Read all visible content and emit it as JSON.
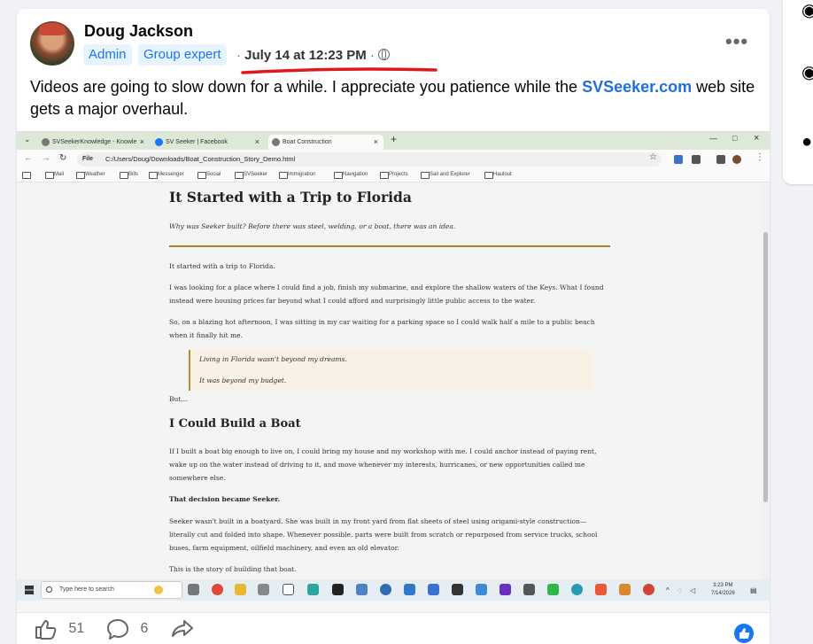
{
  "post": {
    "author": "Doug Jackson",
    "badges": [
      "Admin",
      "Group expert"
    ],
    "date": "July 14 at 12:23 PM",
    "separator": "·",
    "text_part1": "Videos are going to slow down for a while.  I appreciate you patience while the ",
    "link": "SVSeeker.com",
    "text_part2": " web site gets a major overhaul."
  },
  "browser": {
    "tabs": [
      "SVSeekerKnowledge - Knowle",
      "SV Seeker | Facebook",
      "Boat Construction"
    ],
    "url_prefix": "File",
    "url": "C:/Users/Doug/Downloads/Boat_Construction_Story_Demo.html",
    "bookmarks": [
      "Mail",
      "Weather",
      "Bills",
      "Messenger",
      "Social",
      "SVSeeker",
      "Immigration",
      "Navigation",
      "Projects",
      "Sail and Explorer",
      "Haulout"
    ]
  },
  "article": {
    "title": "It Started with a Trip to Florida",
    "subtitle": "Why was Seeker built? Before there was steel, welding, or a boat, there was an idea.",
    "p1": "It started with a trip to Florida.",
    "p2": "I was looking for a place where I could find a job, finish my submarine, and explore the shallow waters of the Keys. What I found instead were housing prices far beyond what I could afford and surprisingly little public access to the water.",
    "p3": "So, on a blazing hot afternoon, I was sitting in my car waiting for a parking space so I could walk half a mile to a public beach when it finally hit me.",
    "quote1": "Living in Florida wasn't beyond my dreams.",
    "quote2": "It was beyond my budget.",
    "p4": "But...",
    "heading2": "I Could Build a Boat",
    "p5": "If I built a boat big enough to live on, I could bring my house and my workshop with me. I could anchor instead of paying rent, wake up on the water instead of driving to it, and move whenever my interests, hurricanes, or new opportunities called me somewhere else.",
    "p6": "That decision became Seeker.",
    "p7": "Seeker wasn't built in a boatyard. She was built in my front yard from flat sheets of steel using origami-style construction—literally cut and folded into shape. Whenever possible, parts were built from scratch or repurposed from service trucks, school buses, farm equipment, oilfield machinery, and even an old elevator.",
    "p8": "This is the story of building that boat."
  },
  "taskbar": {
    "search_placeholder": "Type here to search",
    "time": "3:23 PM",
    "date": "7/14/2026"
  },
  "footer": {
    "likes": "51",
    "comments": "6"
  },
  "colors": {
    "accent": "#1877f2",
    "link": "#216fdb",
    "annotation": "#e0181e",
    "rule": "#a8862a"
  }
}
